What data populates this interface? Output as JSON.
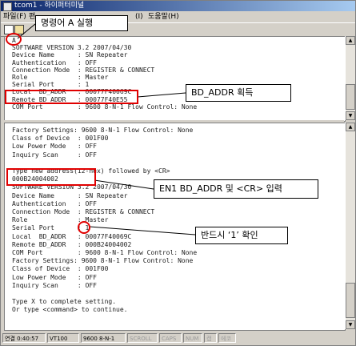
{
  "window": {
    "title": "tcom1 - 하이퍼터미널"
  },
  "menubar": {
    "items": [
      "파일(F)",
      "편",
      "(I)",
      "도움말(H)"
    ]
  },
  "terminal_top": {
    "lines": [
      "A",
      "SOFTWARE VERSION 3.2 2007/04/30",
      "Device Name      : SN Repeater",
      "Authentication   : OFF",
      "Connection Mode  : REGISTER & CONNECT",
      "Role             : Master",
      "Serial Port      : 1",
      "Local  BD_ADDR   : 00077F40069C",
      "Remote BD_ADDR   : 00077F40E55",
      "COM Port         : 9600 8-N-1 Flow Control: None"
    ]
  },
  "terminal_bottom": {
    "lines": [
      "Factory Settings: 9600 8-N-1 Flow Control: None",
      "Class of Device  : 001F00",
      "Low Power Mode   : OFF",
      "Inquiry Scan     : OFF",
      "",
      "Type new address(12-hex) followed by <CR>",
      "000B24004002",
      "SOFTWARE VERSION 3.2 2007/04/30",
      "Device Name      : SN Repeater",
      "Authentication   : OFF",
      "Connection Mode  : REGISTER & CONNECT",
      "Role             : Master",
      "Serial Port      : 1",
      "Local  BD_ADDR   : 00077F40069C",
      "Remote BD_ADDR   : 000B24004002",
      "COM Port         : 9600 8-N-1 Flow Control: None",
      "Factory Settings: 9600 8-N-1 Flow Control: None",
      "Class of Device  : 001F00",
      "Low Power Mode   : OFF",
      "Inquiry Scan     : OFF",
      "",
      "Type X to complete setting.",
      "Or type <command> to continue."
    ]
  },
  "statusbar": {
    "connected": "연결 0:40:57",
    "emulation": "VT100",
    "settings": "9600 8-N-1",
    "scroll": "SCROLL",
    "caps": "CAPS",
    "num": "NUM",
    "capture": "캡",
    "echo": "에코"
  },
  "annotations": {
    "run_a": "명령어  A  실행",
    "bd_addr_get": "BD_ADDR  획득",
    "en1_input": "EN1 BD_ADDR 및 <CR> 입력",
    "confirm_1": "반드시 ‘1’ 확인"
  },
  "colors": {
    "annotation_red": "#e00000",
    "titlebar_start": "#0a246a",
    "titlebar_end": "#a6caf0"
  }
}
